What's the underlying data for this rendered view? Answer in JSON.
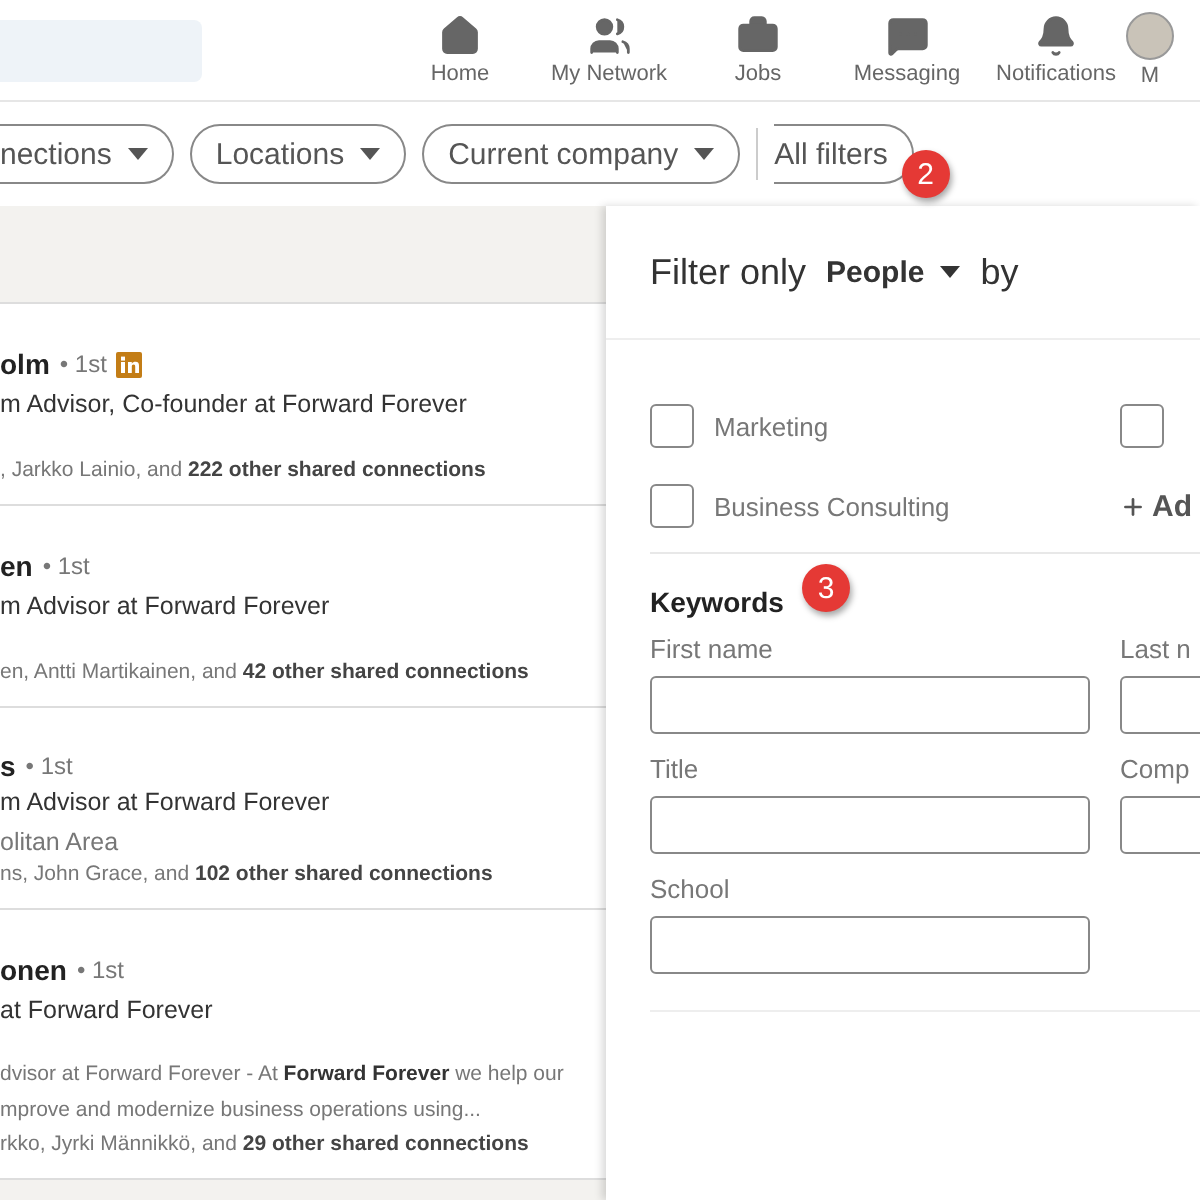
{
  "nav": {
    "items": [
      {
        "kind": "home",
        "label": "Home"
      },
      {
        "kind": "network",
        "label": "My Network"
      },
      {
        "kind": "jobs",
        "label": "Jobs"
      },
      {
        "kind": "messaging",
        "label": "Messaging"
      },
      {
        "kind": "notifications",
        "label": "Notifications"
      },
      {
        "kind": "me",
        "label": "M"
      }
    ]
  },
  "filters": {
    "pills": [
      "nections",
      "Locations",
      "Current company"
    ],
    "all_filters": "All filters",
    "badge": "2"
  },
  "results": [
    {
      "name": "olm",
      "degree": "• 1st",
      "premium": true,
      "headline": "m Advisor, Co-founder at Forward Forever",
      "connections": ", Jarkko Lainio, and **222 other shared connections**"
    },
    {
      "name": "en",
      "degree": "• 1st",
      "premium": false,
      "headline": "m Advisor at Forward Forever",
      "connections": "en, Antti Martikainen, and **42 other shared connections**"
    },
    {
      "name": "s",
      "degree": "• 1st",
      "premium": false,
      "headline": "m Advisor at Forward Forever",
      "location": "olitan Area",
      "connections": "ns, John Grace, and **102 other shared connections**"
    },
    {
      "name": "onen",
      "degree": "• 1st",
      "premium": false,
      "headline": "at Forward Forever",
      "snippet": [
        "dvisor at Forward Forever - At **Forward Forever** we help our",
        "mprove and modernize business operations using..."
      ],
      "connections": "rkko, Jyrki Männikkö, and **29 other shared connections**"
    }
  ],
  "panel": {
    "title_start": "Filter only",
    "type": "People",
    "title_end": "by",
    "checkboxes": [
      {
        "label": "Marketing",
        "checked": false
      },
      {
        "checked": false
      },
      {
        "label": "Business Consulting",
        "checked": false
      }
    ],
    "add_button": "Ad",
    "keywords": {
      "title": "Keywords",
      "badge": "3",
      "fields": [
        {
          "label": "First name"
        },
        {
          "label": "Last n"
        },
        {
          "label": "Title"
        },
        {
          "label": "Comp"
        },
        {
          "label": "School"
        }
      ]
    }
  }
}
